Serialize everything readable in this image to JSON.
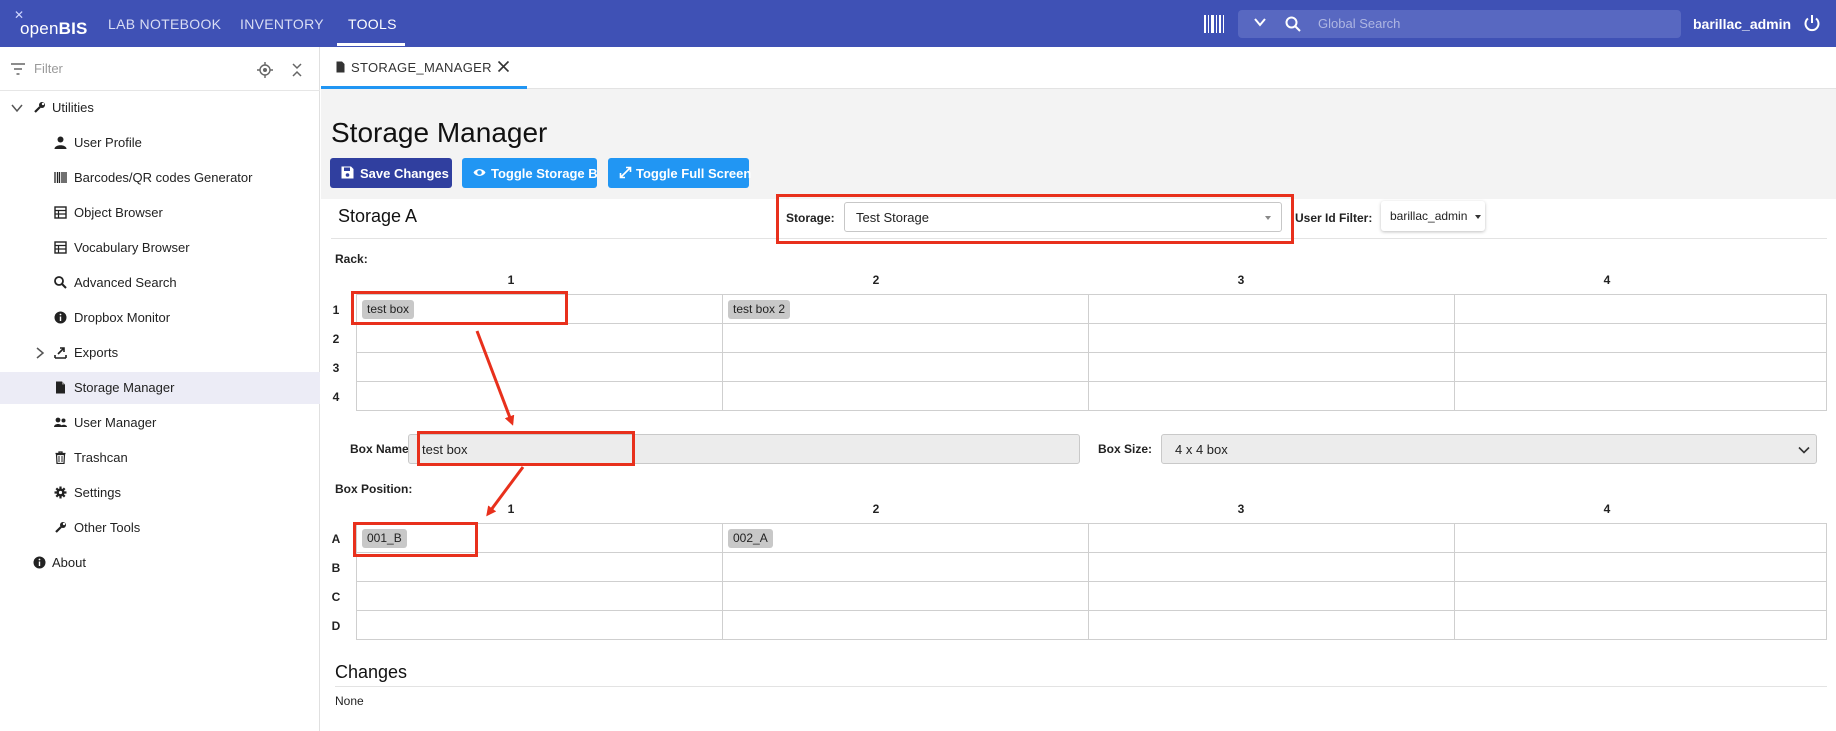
{
  "topbar": {
    "logo_text_strong": "open",
    "logo_text_rest": "BIS",
    "nav": [
      "LAB NOTEBOOK",
      "INVENTORY",
      "TOOLS"
    ],
    "search_placeholder": "Global Search",
    "user": "barillac_admin",
    "bar_color": "#3f51b5"
  },
  "sidebar": {
    "filter_placeholder": "Filter",
    "items": [
      {
        "label": "Utilities",
        "icon": "wrench-icon"
      },
      {
        "label": "User Profile",
        "icon": "person-icon"
      },
      {
        "label": "Barcodes/QR codes Generator",
        "icon": "barcode-icon"
      },
      {
        "label": "Object Browser",
        "icon": "table-icon"
      },
      {
        "label": "Vocabulary Browser",
        "icon": "table-icon"
      },
      {
        "label": "Advanced Search",
        "icon": "search-icon"
      },
      {
        "label": "Dropbox Monitor",
        "icon": "info-icon"
      },
      {
        "label": "Exports",
        "icon": "export-icon"
      },
      {
        "label": "Storage Manager",
        "icon": "document-icon"
      },
      {
        "label": "User Manager",
        "icon": "users-icon"
      },
      {
        "label": "Trashcan",
        "icon": "trash-icon"
      },
      {
        "label": "Settings",
        "icon": "gear-icon"
      },
      {
        "label": "Other Tools",
        "icon": "wrench-icon"
      },
      {
        "label": "About",
        "icon": "info-icon"
      }
    ]
  },
  "tab": {
    "label": "STORAGE_MANAGER"
  },
  "main": {
    "title": "Storage Manager",
    "buttons": {
      "save": "Save Changes",
      "toggle_b": "Toggle Storage B",
      "toggle_full": "Toggle Full Screen"
    },
    "storage_section_title": "Storage A",
    "storage_label": "Storage:",
    "storage_value": "Test Storage",
    "user_id_filter_label": "User Id Filter:",
    "user_id_filter_value": "barillac_admin",
    "rack_label": "Rack:",
    "rack": {
      "columns": [
        "1",
        "2",
        "3",
        "4"
      ],
      "rows": [
        "1",
        "2",
        "3",
        "4"
      ],
      "cells": [
        [
          "test box",
          "test box 2",
          "",
          ""
        ],
        [
          "",
          "",
          "",
          ""
        ],
        [
          "",
          "",
          "",
          ""
        ],
        [
          "",
          "",
          "",
          ""
        ]
      ]
    },
    "box_name_label": "Box Name:",
    "box_name_value": "test box",
    "box_size_label": "Box Size:",
    "box_size_value": "4 x 4 box",
    "box_position_label": "Box Position:",
    "box_position": {
      "columns": [
        "1",
        "2",
        "3",
        "4"
      ],
      "rows": [
        "A",
        "B",
        "C",
        "D"
      ],
      "cells": [
        [
          "001_B",
          "002_A",
          "",
          ""
        ],
        [
          "",
          "",
          "",
          ""
        ],
        [
          "",
          "",
          "",
          ""
        ],
        [
          "",
          "",
          "",
          ""
        ]
      ]
    },
    "changes_title": "Changes",
    "changes_value": "None"
  }
}
